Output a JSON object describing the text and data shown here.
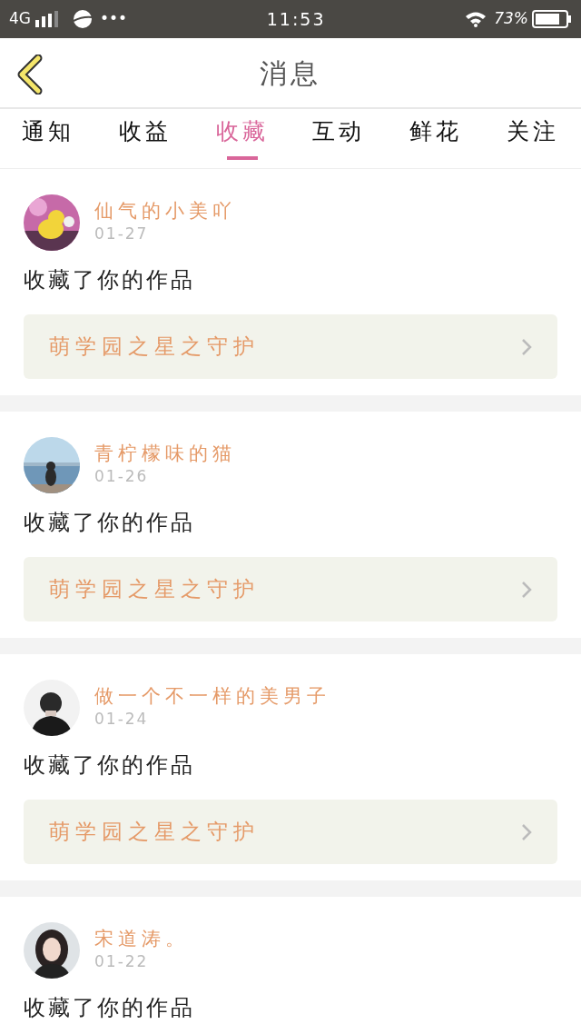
{
  "status_bar": {
    "network": "4G",
    "dots": "•••",
    "time": "11:53",
    "battery": "73%"
  },
  "header": {
    "title": "消息"
  },
  "tabs": [
    {
      "label": "通知",
      "selected": false
    },
    {
      "label": "收益",
      "selected": false
    },
    {
      "label": "收藏",
      "selected": true
    },
    {
      "label": "互动",
      "selected": false
    },
    {
      "label": "鲜花",
      "selected": false
    },
    {
      "label": "关注",
      "selected": false
    }
  ],
  "messages": [
    {
      "user": "仙气的小美吖",
      "date": "01-27",
      "action": "收藏了你的作品",
      "work": "萌学园之星之守护"
    },
    {
      "user": "青柠檬味的猫",
      "date": "01-26",
      "action": "收藏了你的作品",
      "work": "萌学园之星之守护"
    },
    {
      "user": "做一个不一样的美男子",
      "date": "01-24",
      "action": "收藏了你的作品",
      "work": "萌学园之星之守护"
    },
    {
      "user": "宋道涛。",
      "date": "01-22",
      "action": "收藏了你的作品"
    }
  ]
}
